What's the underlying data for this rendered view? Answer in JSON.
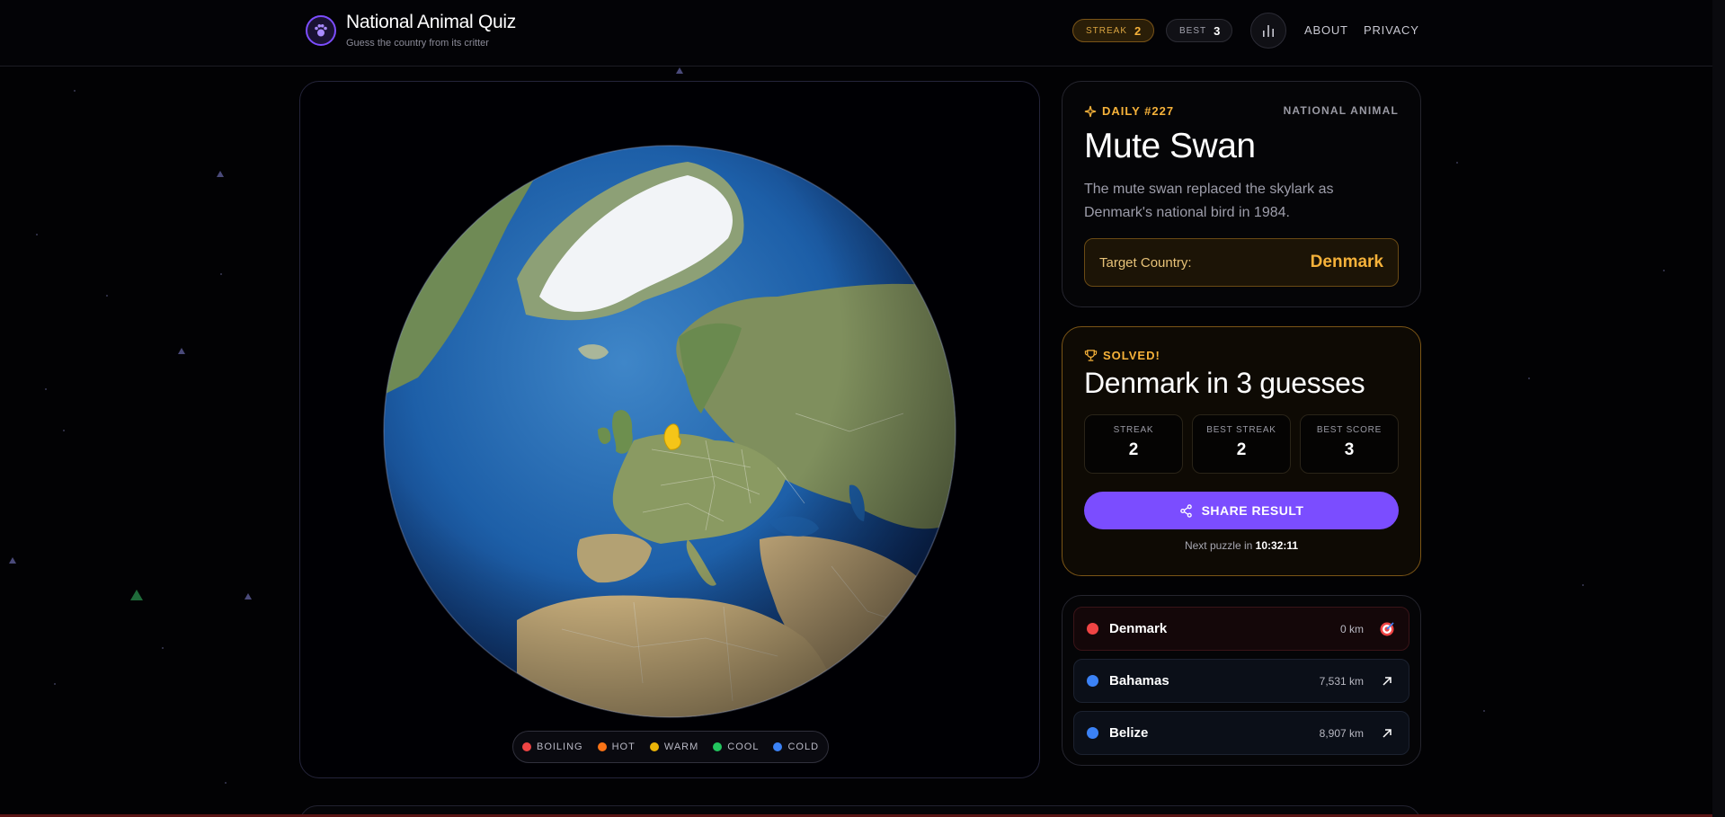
{
  "header": {
    "title": "National Animal Quiz",
    "subtitle": "Guess the country from its critter",
    "streak_label": "STREAK",
    "streak_value": "2",
    "best_label": "BEST",
    "best_value": "3",
    "nav": [
      "ABOUT",
      "PRIVACY"
    ]
  },
  "legend": [
    {
      "label": "BOILING",
      "color": "#ef4444"
    },
    {
      "label": "HOT",
      "color": "#f97316"
    },
    {
      "label": "WARM",
      "color": "#eab308"
    },
    {
      "label": "COOL",
      "color": "#22c55e"
    },
    {
      "label": "COLD",
      "color": "#3b82f6"
    }
  ],
  "puzzle": {
    "daily": "DAILY #227",
    "kind": "NATIONAL ANIMAL",
    "animal": "Mute Swan",
    "fact": "The mute swan replaced the skylark as Denmark's national bird in 1984.",
    "target_label": "Target Country:",
    "target_value": "Denmark"
  },
  "result": {
    "label": "SOLVED!",
    "title": "Denmark in 3 guesses",
    "stats": [
      {
        "label": "STREAK",
        "value": "2"
      },
      {
        "label": "BEST STREAK",
        "value": "2"
      },
      {
        "label": "BEST SCORE",
        "value": "3"
      }
    ],
    "share_label": "SHARE RESULT",
    "next_prefix": "Next puzzle in",
    "next_time": "10:32:11"
  },
  "guesses": [
    {
      "country": "Denmark",
      "distance": "0 km",
      "color": "#ef4444",
      "icon": "target-icon"
    },
    {
      "country": "Bahamas",
      "distance": "7,531 km",
      "color": "#3b82f6",
      "icon": "arrow-up-right-icon"
    },
    {
      "country": "Belize",
      "distance": "8,907 km",
      "color": "#3b82f6",
      "icon": "arrow-up-right-icon"
    }
  ],
  "colors": {
    "accent": "#7b4dff",
    "gold": "#f6b23a",
    "highlight_country": "#f5c518"
  }
}
